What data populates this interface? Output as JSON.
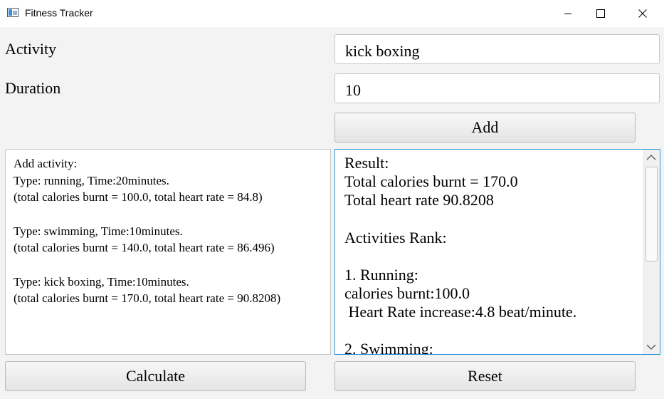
{
  "window": {
    "title": "Fitness Tracker",
    "controls": {
      "minimize": "—",
      "maximize": "☐",
      "close": "✕"
    }
  },
  "form": {
    "activity_label": "Activity",
    "activity_value": "kick boxing",
    "duration_label": "Duration",
    "duration_value": "10",
    "add_label": "Add"
  },
  "log": {
    "lines": [
      "Add activity:",
      "Type: running, Time:20minutes.",
      "(total calories burnt = 100.0, total heart rate = 84.8)",
      "",
      "Type: swimming, Time:10minutes.",
      "(total calories burnt = 140.0, total heart rate = 86.496)",
      "",
      "Type: kick boxing, Time:10minutes.",
      "(total calories burnt = 170.0, total heart rate = 90.8208)"
    ]
  },
  "result": {
    "lines": [
      "Result:",
      "Total calories burnt = 170.0",
      "Total heart rate 90.8208",
      "",
      "Activities Rank:",
      "",
      "1. Running:",
      "calories burnt:100.0",
      " Heart Rate increase:4.8 beat/minute.",
      "",
      "2. Swimming:"
    ]
  },
  "buttons": {
    "calculate_label": "Calculate",
    "reset_label": "Reset"
  },
  "scrollbar": {
    "up_icon": "chevron-up-icon",
    "down_icon": "chevron-down-icon"
  },
  "colors": {
    "accent_border": "#2a9ad4"
  }
}
